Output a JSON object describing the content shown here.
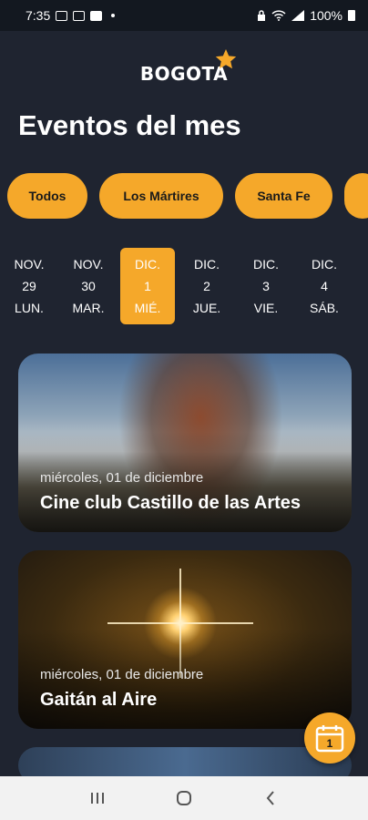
{
  "status_bar": {
    "time": "7:35",
    "battery": "100%",
    "icons": [
      "gallery-icon",
      "gmail-icon",
      "flipboard-icon",
      "lock-icon",
      "wifi-icon",
      "signal-icon",
      "battery-icon"
    ]
  },
  "header": {
    "logo_text": "BOGOTA",
    "title": "Eventos del mes"
  },
  "filters": [
    {
      "label": "Todos"
    },
    {
      "label": "Los Mártires"
    },
    {
      "label": "Santa Fe"
    }
  ],
  "dates": [
    {
      "month": "NOV.",
      "day": "29",
      "weekday": "LUN.",
      "selected": false
    },
    {
      "month": "NOV.",
      "day": "30",
      "weekday": "MAR.",
      "selected": false
    },
    {
      "month": "DIC.",
      "day": "1",
      "weekday": "MIÉ.",
      "selected": true
    },
    {
      "month": "DIC.",
      "day": "2",
      "weekday": "JUE.",
      "selected": false
    },
    {
      "month": "DIC.",
      "day": "3",
      "weekday": "VIE.",
      "selected": false
    },
    {
      "month": "DIC.",
      "day": "4",
      "weekday": "SÁB.",
      "selected": false
    }
  ],
  "events": [
    {
      "date": "miércoles, 01 de diciembre",
      "title": "Cine club Castillo de las Artes"
    },
    {
      "date": "miércoles, 01 de diciembre",
      "title": "Gaitán al Aire"
    }
  ],
  "fab": {
    "calendar_day": "1"
  },
  "colors": {
    "accent": "#f5a82a",
    "background": "#1f2430"
  }
}
